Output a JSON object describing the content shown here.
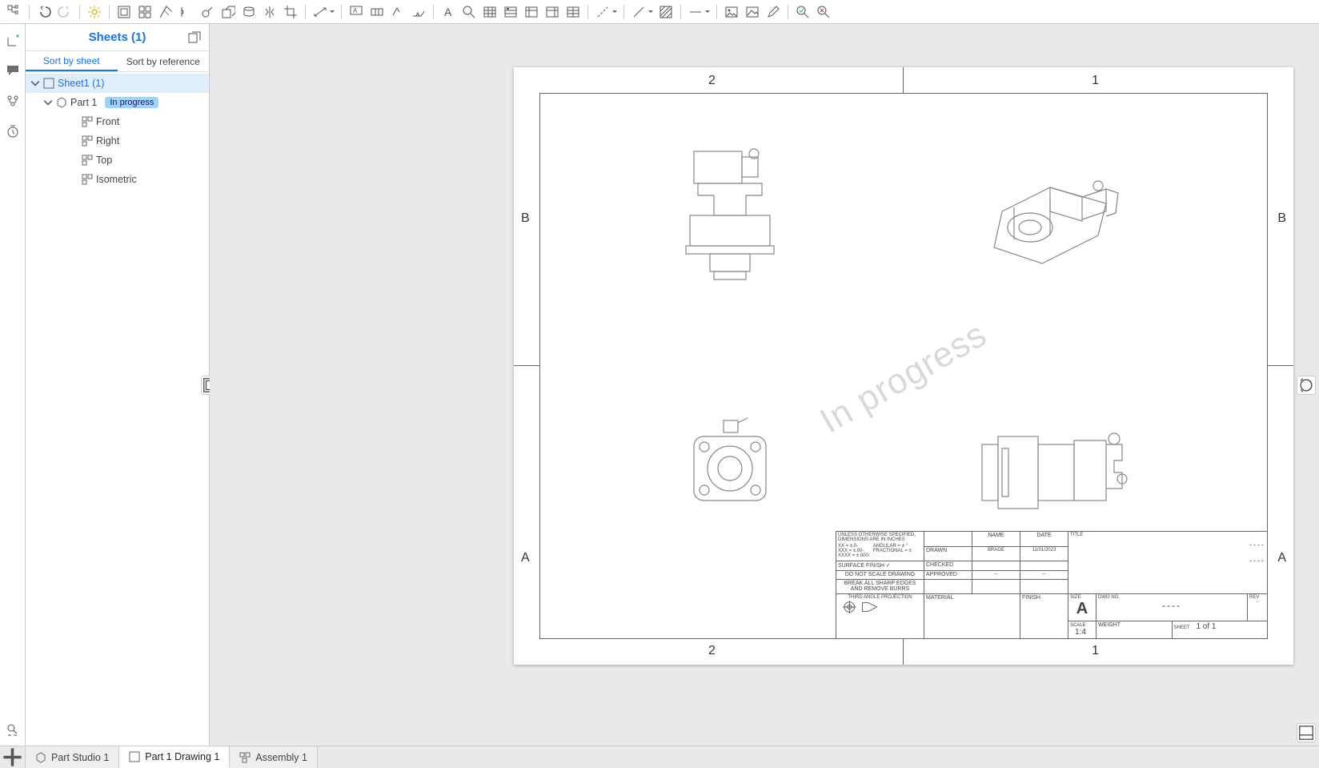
{
  "toolbar": {
    "icons": [
      "feature-tree-icon",
      "undo-icon",
      "redo-icon",
      "gear-icon",
      "insert-view-icon",
      "four-views-icon",
      "section-view-icon",
      "break-view-icon",
      "detail-view-icon",
      "auxiliary-view-icon",
      "revolve-section-icon",
      "mirror-view-icon",
      "crop-icon",
      "dimension-icon",
      "note-icon",
      "geometric-tolerance-icon",
      "check-icon",
      "line-note-icon",
      "text-icon",
      "magnify-icon",
      "table-icon",
      "hole-table-icon",
      "bom-icon",
      "revision-table-icon",
      "cut-list-icon",
      "centerline-icon",
      "line-icon",
      "hatch-icon",
      "line-style-icon",
      "image-icon",
      "picture-icon",
      "edit-icon",
      "inspect-icon",
      "inspect-fail-icon"
    ]
  },
  "leftRail": {
    "buttons": [
      "add-view-icon",
      "chat-icon",
      "versions-icon",
      "history-icon"
    ]
  },
  "sidebar": {
    "title": "Sheets (1)",
    "sort_tabs": {
      "sheet": "Sort by sheet",
      "reference": "Sort by reference"
    },
    "tree": {
      "sheet": "Sheet1 (1)",
      "part": "Part 1",
      "badge": "In progress",
      "views": [
        "Front",
        "Right",
        "Top",
        "Isometric"
      ]
    }
  },
  "canvas": {
    "watermark": "In progress",
    "zones": {
      "cols": [
        "2",
        "1"
      ],
      "rows": [
        "B",
        "A"
      ]
    }
  },
  "titleblock": {
    "spec_header": "UNLESS OTHERWISE SPECIFIED, DIMENSIONS ARE IN INCHES",
    "tol_lines": [
      "XX = ±.0-",
      "XXX = ±.00-",
      "XXXX = ±.000-",
      "ANGULAR = ± °",
      "FRACTIONAL = ±"
    ],
    "surface": "SURFACE FINISH",
    "name_h": "NAME",
    "date_h": "DATE",
    "drawn": "DRAWN",
    "drawn_name": "BRAGE",
    "drawn_date": "11/01/2023",
    "checked": "CHECKED",
    "approved": "APPROVED",
    "nodim": "DO NOT SCALE DRAWING",
    "break": "BREAK ALL SHARP EDGES AND REMOVE BURRS",
    "proj": "THIRD ANGLE PROJECTION",
    "material": "MATERIAL",
    "finish": "FINISH",
    "title_h": "TITLE",
    "title_val": "----",
    "size_h": "SIZE",
    "size_val": "A",
    "dwg_h": "DWG NO.",
    "dwg_val": "----",
    "rev_h": "REV",
    "rev_val": "-",
    "scale_h": "SCALE",
    "scale_val": "1:4",
    "weight_h": "WEIGHT",
    "sheet_h": "SHEET",
    "sheet_val": "1 of 1"
  },
  "tabs": {
    "part_studio": "Part Studio 1",
    "drawing": "Part 1 Drawing 1",
    "assembly": "Assembly 1"
  }
}
